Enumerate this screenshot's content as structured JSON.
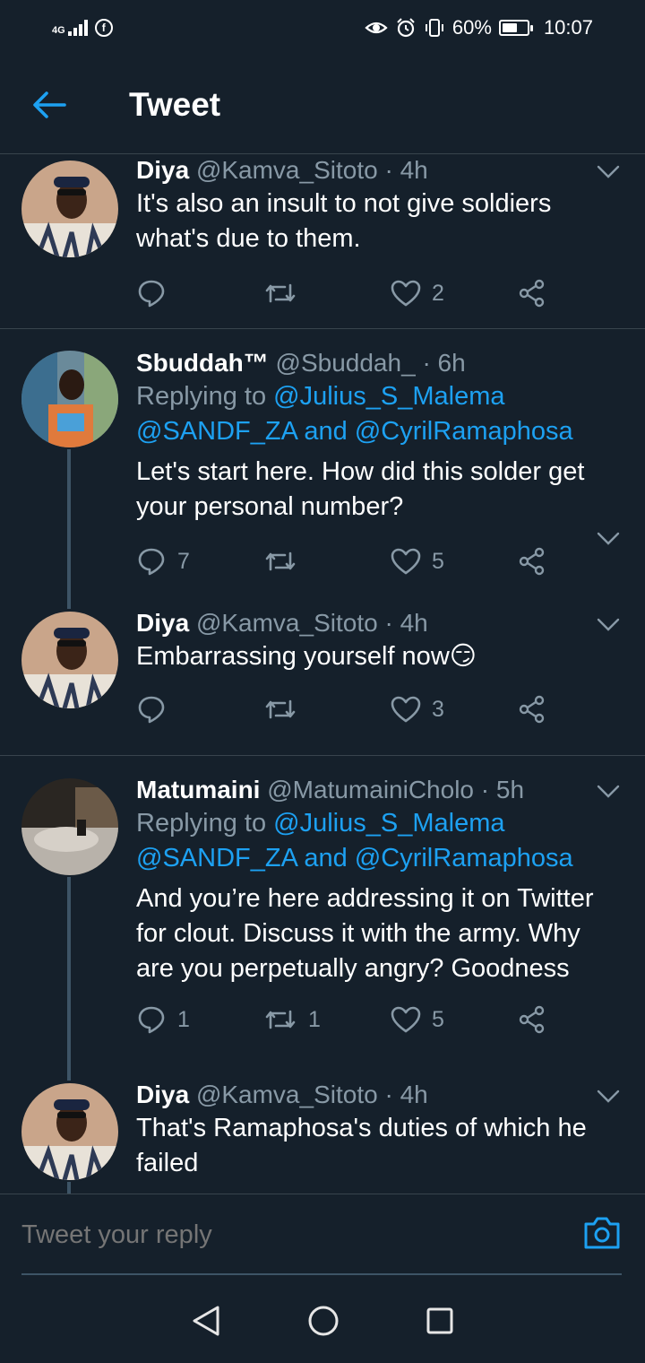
{
  "status_bar": {
    "network": "4G",
    "facebook_badge": "f",
    "battery": "60%",
    "time": "10:07"
  },
  "header": {
    "title": "Tweet"
  },
  "tweets": [
    {
      "name": "Diya",
      "handle": "@Kamva_Sitoto",
      "time": "· 4h",
      "text_lines": [
        "It's also an insult to not give soldiers",
        "what's due to them."
      ],
      "replies": "",
      "retweets": "",
      "likes": "2"
    },
    {
      "name": "Sbuddah™",
      "handle": "@Sbuddah_",
      "time": "· 6h",
      "replying_prefix": "Replying to",
      "reply_mention_1": "@Julius_S_Malema",
      "reply_mention_2": "@SANDF_ZA",
      "reply_and": "and",
      "reply_mention_3": "@CyrilRamaphosa",
      "text_lines": [
        "Let's start here. How did this solder get",
        "your personal number?"
      ],
      "replies": "7",
      "retweets": "",
      "likes": "5"
    },
    {
      "name": "Diya",
      "handle": "@Kamva_Sitoto",
      "time": "· 4h",
      "text_lines": [
        "Embarrassing yourself now"
      ],
      "emoji": "😏",
      "replies": "",
      "retweets": "",
      "likes": "3"
    },
    {
      "name": "Matumaini",
      "handle": "@MatumainiCholo",
      "time": "· 5h",
      "replying_prefix": "Replying to",
      "reply_mention_1": "@Julius_S_Malema",
      "reply_mention_2": "@SANDF_ZA",
      "reply_and": "and",
      "reply_mention_3": "@CyrilRamaphosa",
      "text_lines": [
        "And you’re here addressing it on Twitter",
        "for clout. Discuss it with the army. Why",
        "are you perpetually angry? Goodness"
      ],
      "replies": "1",
      "retweets": "1",
      "likes": "5"
    },
    {
      "name": "Diya",
      "handle": "@Kamva_Sitoto",
      "time": "· 4h",
      "text_lines": [
        "That's Ramaphosa's duties of which he",
        "failed"
      ]
    }
  ],
  "reply_bar": {
    "placeholder": "Tweet your reply"
  },
  "colors": {
    "background": "#15202b",
    "accent": "#1da1f2",
    "muted": "#8899a6",
    "divider": "#38444d"
  },
  "icons": [
    "back-arrow-icon",
    "reply-icon",
    "retweet-icon",
    "like-icon",
    "share-icon",
    "chevron-down-icon",
    "camera-icon",
    "nav-back-icon",
    "nav-home-icon",
    "nav-recents-icon"
  ]
}
